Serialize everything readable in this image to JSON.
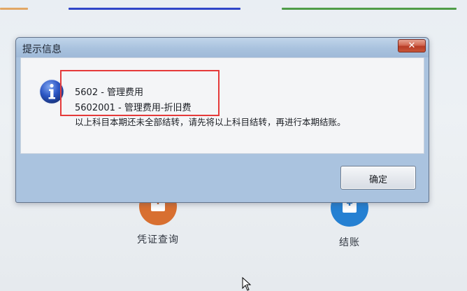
{
  "dialog": {
    "title": "提示信息",
    "close_icon": "close-icon",
    "info_icon": "info-icon",
    "message_lines": [
      "5602 - 管理费用",
      "5602001 - 管理费用-折旧费",
      "以上科目本期还未全部结转，请先将以上科目结转，再进行本期结账。"
    ],
    "confirm_label": "确定"
  },
  "background": {
    "items": [
      {
        "label": "凭证查询",
        "icon": "voucher-icon",
        "glyph": "¥"
      },
      {
        "label": "结账",
        "icon": "checkout-icon",
        "glyph": "¥"
      }
    ]
  },
  "colors": {
    "dialog_frame": "#aac3df",
    "highlight": "#e53a3a",
    "voucher_icon": "#d86f30",
    "checkout_icon": "#2580d2"
  }
}
